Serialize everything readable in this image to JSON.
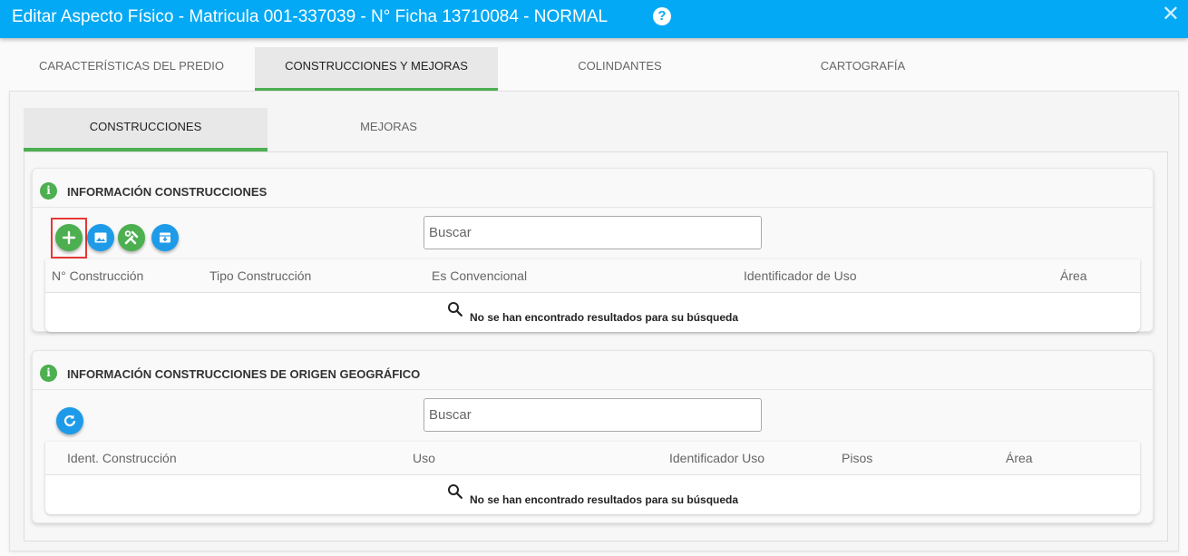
{
  "window": {
    "title": "Editar Aspecto Físico - Matricula 001-337039 - N° Ficha 13710084 - NORMAL",
    "help_label": "?",
    "close_label": "✕"
  },
  "main_tabs": [
    {
      "label": "CARACTERÍSTICAS DEL PREDIO",
      "active": false
    },
    {
      "label": "CONSTRUCCIONES Y MEJORAS",
      "active": true
    },
    {
      "label": "COLINDANTES",
      "active": false
    },
    {
      "label": "CARTOGRAFÍA",
      "active": false
    }
  ],
  "sub_tabs": [
    {
      "label": "CONSTRUCCIONES",
      "active": true
    },
    {
      "label": "MEJORAS",
      "active": false
    }
  ],
  "construcciones": {
    "title": "INFORMACIÓN CONSTRUCCIONES",
    "info_icon": "i",
    "search_placeholder": "Buscar",
    "columns": [
      "N° Construcción",
      "Tipo Construcción",
      "Es Convencional",
      "Identificador de Uso",
      "Área"
    ],
    "empty_message": "No se han encontrado resultados para su búsqueda",
    "toolbar": [
      "add-icon",
      "image-icon",
      "tools-icon",
      "archive-icon"
    ]
  },
  "origen_geografico": {
    "title": "INFORMACIÓN CONSTRUCCIONES DE ORIGEN GEOGRÁFICO",
    "info_icon": "i",
    "search_placeholder": "Buscar",
    "columns": [
      "Ident. Construcción",
      "Uso",
      "Identificador Uso",
      "Pisos",
      "Área"
    ],
    "empty_message": "No se han encontrado resultados para su búsqueda",
    "toolbar": [
      "refresh-icon"
    ]
  },
  "colors": {
    "titlebar": "#03a9f4",
    "accent_green": "#4caf50",
    "accent_blue": "#1e9be8",
    "highlight_red": "#e53935"
  }
}
